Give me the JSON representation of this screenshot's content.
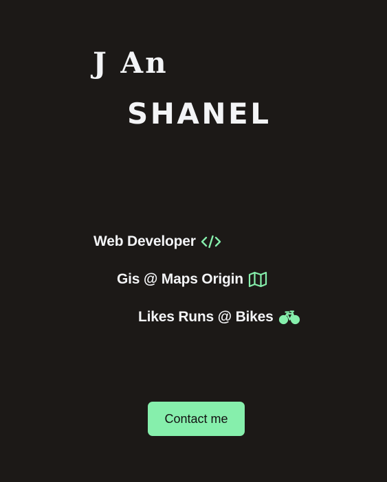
{
  "header": {
    "first_name": "J An",
    "last_name": "SHANEL"
  },
  "roles": [
    {
      "label": "Web Developer",
      "icon": "code-icon"
    },
    {
      "label": "Gis @ Maps Origin",
      "icon": "map-icon"
    },
    {
      "label": "Likes Runs @ Bikes",
      "icon": "bicycle-icon"
    }
  ],
  "contact_button": {
    "label": "Contact me"
  },
  "colors": {
    "background": "#1c1917",
    "text": "#f3f4f6",
    "accent": "#86efac"
  }
}
